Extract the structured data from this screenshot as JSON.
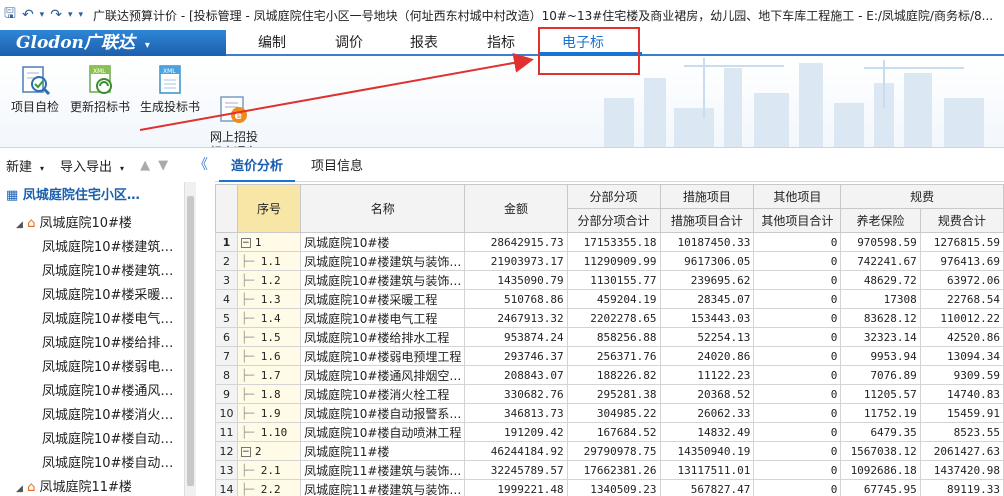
{
  "titlebar": {
    "text": "广联达预算计价 - [投标管理 - 凤城庭院住宅小区一号地块（何址西东村城中村改造）10#~13#住宅楼及商业裙房，幼儿园、地下车库工程施工 - E:/凤城庭院/商务标/8..."
  },
  "menubar": {
    "logo": "Glodon广联达",
    "logo_arrow": "▾",
    "items": [
      "编制",
      "调价",
      "报表",
      "指标",
      "电子标"
    ],
    "active": "电子标"
  },
  "ribbon": {
    "buttons": [
      {
        "label": "项目自检",
        "icon": "check-icon"
      },
      {
        "label": "更新招标书",
        "icon": "update-xml-icon"
      },
      {
        "label": "生成投标书",
        "icon": "xml-file-icon"
      },
      {
        "label": "网上招投\n标直通车",
        "icon": "web-bid-icon"
      }
    ]
  },
  "left_toolbar": {
    "new": "新建",
    "import_export": "导入导出",
    "up": "▲",
    "down": "▼",
    "collapse": "《"
  },
  "tree": {
    "root": "凤城庭院住宅小区…",
    "building1": "凤城庭院10#楼",
    "children": [
      "凤城庭院10#楼建筑…",
      "凤城庭院10#楼建筑…",
      "凤城庭院10#楼采暖…",
      "凤城庭院10#楼电气…",
      "凤城庭院10#楼给排…",
      "凤城庭院10#楼弱电…",
      "凤城庭院10#楼通风…",
      "凤城庭院10#楼消火…",
      "凤城庭院10#楼自动…",
      "凤城庭院10#楼自动…"
    ],
    "building2": "凤城庭院11#楼"
  },
  "tabs": [
    "造价分析",
    "项目信息"
  ],
  "table": {
    "headers": {
      "seq": "序号",
      "name": "名称",
      "amount": "金额",
      "group_fbfx": "分部分项",
      "group_csxm": "措施项目",
      "group_qtxm": "其他项目",
      "group_gf": "规费",
      "fbfx_total": "分部分项合计",
      "csxm_total": "措施项目合计",
      "qtxm_total": "其他项目合计",
      "pension": "养老保险",
      "gf_total": "规费合计"
    },
    "rows": [
      {
        "rn": "1",
        "seq": "1",
        "level": 0,
        "name": "凤城庭院10#楼",
        "amount": "28642915.73",
        "fbfx": "17153355.18",
        "csxm": "10187450.33",
        "qtxm": "0",
        "pension": "970598.59",
        "gf": "1276815.59"
      },
      {
        "rn": "2",
        "seq": "1.1",
        "level": 1,
        "name": "凤城庭院10#楼建筑与装饰…",
        "amount": "21903973.17",
        "fbfx": "11290909.99",
        "csxm": "9617306.05",
        "qtxm": "0",
        "pension": "742241.67",
        "gf": "976413.69"
      },
      {
        "rn": "3",
        "seq": "1.2",
        "level": 1,
        "name": "凤城庭院10#楼建筑与装饰…",
        "amount": "1435090.79",
        "fbfx": "1130155.77",
        "csxm": "239695.62",
        "qtxm": "0",
        "pension": "48629.72",
        "gf": "63972.06"
      },
      {
        "rn": "4",
        "seq": "1.3",
        "level": 1,
        "name": "凤城庭院10#楼采暖工程",
        "amount": "510768.86",
        "fbfx": "459204.19",
        "csxm": "28345.07",
        "qtxm": "0",
        "pension": "17308",
        "gf": "22768.54"
      },
      {
        "rn": "5",
        "seq": "1.4",
        "level": 1,
        "name": "凤城庭院10#楼电气工程",
        "amount": "2467913.32",
        "fbfx": "2202278.65",
        "csxm": "153443.03",
        "qtxm": "0",
        "pension": "83628.12",
        "gf": "110012.22"
      },
      {
        "rn": "6",
        "seq": "1.5",
        "level": 1,
        "name": "凤城庭院10#楼给排水工程",
        "amount": "953874.24",
        "fbfx": "858256.88",
        "csxm": "52254.13",
        "qtxm": "0",
        "pension": "32323.14",
        "gf": "42520.86"
      },
      {
        "rn": "7",
        "seq": "1.6",
        "level": 1,
        "name": "凤城庭院10#楼弱电预埋工程",
        "amount": "293746.37",
        "fbfx": "256371.76",
        "csxm": "24020.86",
        "qtxm": "0",
        "pension": "9953.94",
        "gf": "13094.34"
      },
      {
        "rn": "8",
        "seq": "1.7",
        "level": 1,
        "name": "凤城庭院10#楼通风排烟空…",
        "amount": "208843.07",
        "fbfx": "188226.82",
        "csxm": "11122.23",
        "qtxm": "0",
        "pension": "7076.89",
        "gf": "9309.59"
      },
      {
        "rn": "9",
        "seq": "1.8",
        "level": 1,
        "name": "凤城庭院10#楼消火栓工程",
        "amount": "330682.76",
        "fbfx": "295281.38",
        "csxm": "20368.52",
        "qtxm": "0",
        "pension": "11205.57",
        "gf": "14740.83"
      },
      {
        "rn": "10",
        "seq": "1.9",
        "level": 1,
        "name": "凤城庭院10#楼自动报警系…",
        "amount": "346813.73",
        "fbfx": "304985.22",
        "csxm": "26062.33",
        "qtxm": "0",
        "pension": "11752.19",
        "gf": "15459.91"
      },
      {
        "rn": "11",
        "seq": "1.10",
        "level": 1,
        "name": "凤城庭院10#楼自动喷淋工程",
        "amount": "191209.42",
        "fbfx": "167684.52",
        "csxm": "14832.49",
        "qtxm": "0",
        "pension": "6479.35",
        "gf": "8523.55"
      },
      {
        "rn": "12",
        "seq": "2",
        "level": 0,
        "name": "凤城庭院11#楼",
        "amount": "46244184.92",
        "fbfx": "29790978.75",
        "csxm": "14350940.19",
        "qtxm": "0",
        "pension": "1567038.12",
        "gf": "2061427.63"
      },
      {
        "rn": "13",
        "seq": "2.1",
        "level": 1,
        "name": "凤城庭院11#楼建筑与装饰…",
        "amount": "32245789.57",
        "fbfx": "17662381.26",
        "csxm": "13117511.01",
        "qtxm": "0",
        "pension": "1092686.18",
        "gf": "1437420.98"
      },
      {
        "rn": "14",
        "seq": "2.2",
        "level": 1,
        "name": "凤城庭院11#楼建筑与装饰…",
        "amount": "1999221.48",
        "fbfx": "1340509.23",
        "csxm": "567827.47",
        "qtxm": "0",
        "pension": "67745.95",
        "gf": "89119.33"
      }
    ]
  },
  "colors": {
    "accent": "#1a73d0",
    "annotation": "#e0302f",
    "seq_header": "#f7e6a6"
  }
}
